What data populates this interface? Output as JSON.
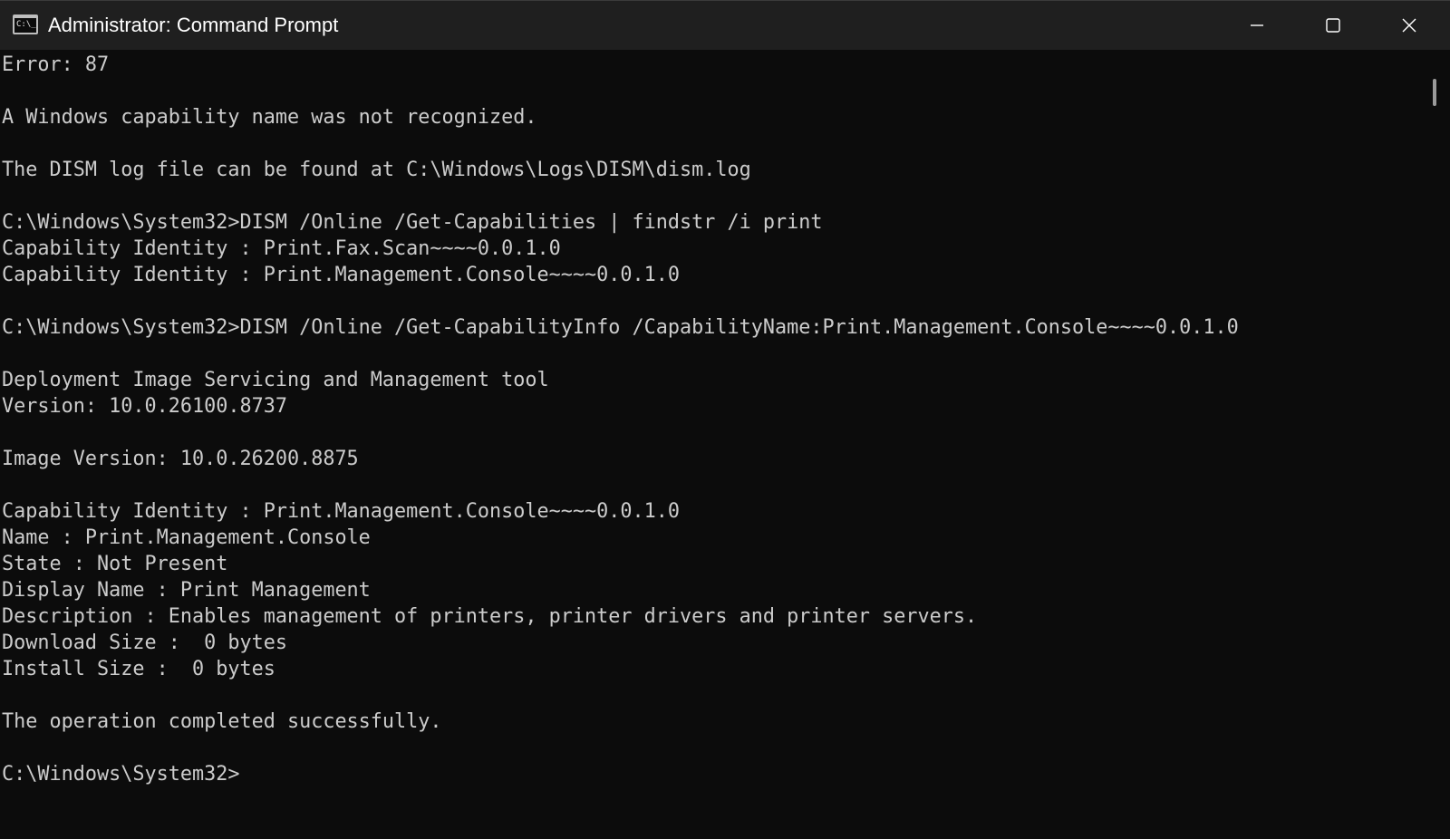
{
  "window": {
    "title": "Administrator: Command Prompt",
    "app_icon_glyph": "C:\\_"
  },
  "titlebar": {
    "minimize_icon": "minimize-icon",
    "maximize_icon": "maximize-icon",
    "close_icon": "close-icon"
  },
  "terminal": {
    "lines": [
      "Error: 87",
      "",
      "A Windows capability name was not recognized.",
      "",
      "The DISM log file can be found at C:\\Windows\\Logs\\DISM\\dism.log",
      "",
      "C:\\Windows\\System32>DISM /Online /Get-Capabilities | findstr /i print",
      "Capability Identity : Print.Fax.Scan~~~~0.0.1.0",
      "Capability Identity : Print.Management.Console~~~~0.0.1.0",
      "",
      "C:\\Windows\\System32>DISM /Online /Get-CapabilityInfo /CapabilityName:Print.Management.Console~~~~0.0.1.0",
      "",
      "Deployment Image Servicing and Management tool",
      "Version: 10.0.26100.8737",
      "",
      "Image Version: 10.0.26200.8875",
      "",
      "Capability Identity : Print.Management.Console~~~~0.0.1.0",
      "Name : Print.Management.Console",
      "State : Not Present",
      "Display Name : Print Management",
      "Description : Enables management of printers, printer drivers and printer servers.",
      "Download Size :  0 bytes",
      "Install Size :  0 bytes",
      "",
      "The operation completed successfully.",
      "",
      "C:\\Windows\\System32>"
    ]
  },
  "colors": {
    "background": "#0c0c0c",
    "foreground": "#cccccc",
    "titlebar": "#1f1f1f"
  }
}
